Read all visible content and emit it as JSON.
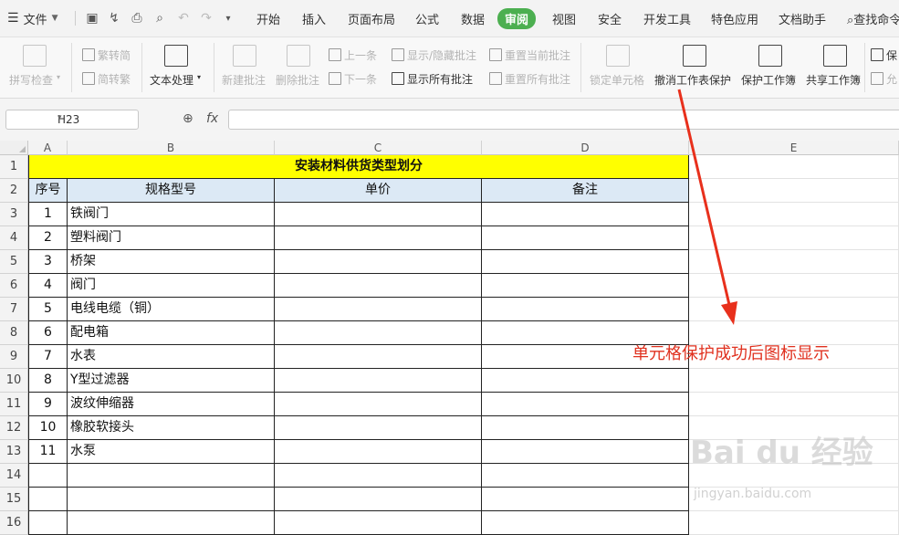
{
  "menu": {
    "file_label": "文件",
    "tabs": [
      "开始",
      "插入",
      "页面布局",
      "公式",
      "数据",
      "审阅",
      "视图",
      "安全",
      "开发工具",
      "特色应用",
      "文档助手"
    ],
    "active_tab": "审阅",
    "search_label": "查找命令"
  },
  "ribbon": {
    "spell_check": "拼写检查",
    "trad_to_simp": "繁转简",
    "simp_to_trad": "简转繁",
    "text_processing": "文本处理",
    "new_comment": "新建批注",
    "delete_comment": "删除批注",
    "prev": "上一条",
    "next": "下一条",
    "show_hide_comment": "显示/隐藏批注",
    "show_all_comments": "显示所有批注",
    "reset_current_comment": "重置当前批注",
    "reset_all_comments": "重置所有批注",
    "lock_cell": "锁定单元格",
    "unprotect_sheet": "撤消工作表保护",
    "protect_workbook": "保护工作簿",
    "share_workbook": "共享工作簿",
    "protect_short": "保",
    "allow_short": "允"
  },
  "formula_bar": {
    "cell_ref": "H23",
    "fx": "fx"
  },
  "sheet": {
    "columns": [
      "A",
      "B",
      "C",
      "D",
      "E"
    ],
    "rows": [
      "1",
      "2",
      "3",
      "4",
      "5",
      "6",
      "7",
      "8",
      "9",
      "10",
      "11",
      "12",
      "13",
      "14",
      "15",
      "16"
    ],
    "title": "安装材料供货类型划分",
    "headers": [
      "序号",
      "规格型号",
      "单价",
      "备注"
    ],
    "items": [
      {
        "no": "1",
        "name": "铁阀门"
      },
      {
        "no": "2",
        "name": "塑料阀门"
      },
      {
        "no": "3",
        "name": "桥架"
      },
      {
        "no": "4",
        "name": "阀门"
      },
      {
        "no": "5",
        "name": "电线电缆（铜）"
      },
      {
        "no": "6",
        "name": "配电箱"
      },
      {
        "no": "7",
        "name": "水表"
      },
      {
        "no": "8",
        "name": "Y型过滤器"
      },
      {
        "no": "9",
        "name": "波纹伸缩器"
      },
      {
        "no": "10",
        "name": "橡胶软接头"
      },
      {
        "no": "11",
        "name": "水泵"
      }
    ]
  },
  "annotation": {
    "text": "单元格保护成功后图标显示",
    "color": "#e0311f"
  },
  "watermark": {
    "brand": "Bai du 经验",
    "url": "jingyan.baidu.com"
  }
}
